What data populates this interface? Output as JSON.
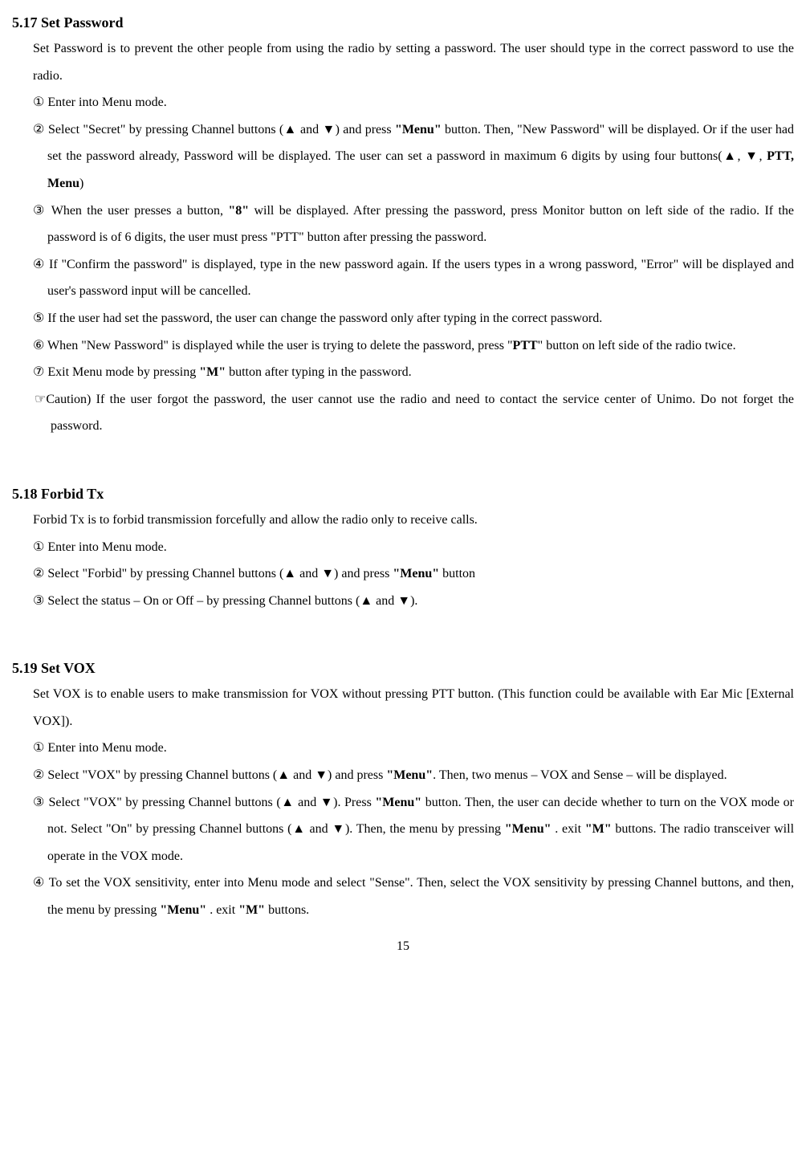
{
  "s1": {
    "heading": "5.17 Set Password",
    "intro": "Set Password is to prevent the other people from using the radio by setting a password. The user should type in the correct password to use the radio.",
    "i1": "① Enter into Menu mode.",
    "i2a": "② Select \"Secret\" by pressing Channel buttons (▲ and ▼) and press ",
    "i2b": "\"Menu\"",
    "i2c": " button.  Then, \"New Password\" will be displayed. Or if the user had set the password already, Password will be displayed.  The user can set a password in maximum 6 digits by using four buttons(▲, ▼, ",
    "i2d": "PTT, Menu",
    "i2e": ")",
    "i3a": "③ When the user presses a button, ",
    "i3b": "\"8\"",
    "i3c": " will be displayed. After pressing the password, press Monitor button on left side of the radio. If the password is of 6 digits, the user must press \"PTT\" button after pressing the password.",
    "i4": "④ If \"Confirm the password\" is displayed, type in the new password again. If the users types in a wrong password, \"Error\" will be displayed and user's password input will be cancelled.",
    "i5": "⑤ If the user had set the password, the user can change the password only after typing in the correct password.",
    "i6a": "⑥ When \"New Password\" is displayed while the user is trying to delete the password, press \"",
    "i6b": "PTT",
    "i6c": "\" button on left side of the radio twice.",
    "i7a": "⑦ Exit Menu mode by pressing ",
    "i7b": "\"M\"",
    "i7c": " button after typing in the password.",
    "caution": "☞Caution) If the user forgot the password, the user cannot use the radio and need to contact the service center of Unimo. Do not forget the password."
  },
  "s2": {
    "heading": "5.18 Forbid Tx",
    "intro": "Forbid Tx is to forbid transmission forcefully and allow the radio only to receive calls.",
    "i1": "① Enter into Menu mode.",
    "i2a": "② Select \"Forbid\" by pressing Channel buttons (▲ and ▼) and press ",
    "i2b": "\"Menu\"",
    "i2c": " button",
    "i3": "③ Select the status – On or Off – by pressing Channel buttons (▲ and ▼)."
  },
  "s3": {
    "heading": "5.19 Set VOX",
    "intro": "Set VOX is to enable users to make transmission for VOX without pressing PTT button. (This function could be available with Ear Mic [External VOX]).",
    "i1": "① Enter into Menu mode.",
    "i2a": "② Select \"VOX\" by pressing Channel buttons (▲ and ▼) and press ",
    "i2b": "\"Menu\"",
    "i2c": ". Then, two menus – VOX and Sense – will be displayed.",
    "i3a": "③ Select \"VOX\" by pressing Channel buttons (▲ and ▼). Press ",
    "i3b": "\"Menu\"",
    "i3c": " button. Then, the user can decide whether to turn on the VOX mode or not. Select \"On\" by pressing Channel buttons (▲ and ▼). Then, the menu by pressing ",
    "i3d": "\"Menu\"",
    "i3e": " .  exit ",
    "i3f": "\"M\"",
    "i3g": " buttons. The radio transceiver will operate in the VOX mode.",
    "i4a": "④ To set the VOX sensitivity, enter into Menu mode and select \"Sense\". Then, select the VOX sensitivity by pressing Channel buttons, and then, the menu by pressing ",
    "i4b": "\"Menu\"",
    "i4c": " . exit ",
    "i4d": "\"M\"",
    "i4e": " buttons."
  },
  "page": "15"
}
